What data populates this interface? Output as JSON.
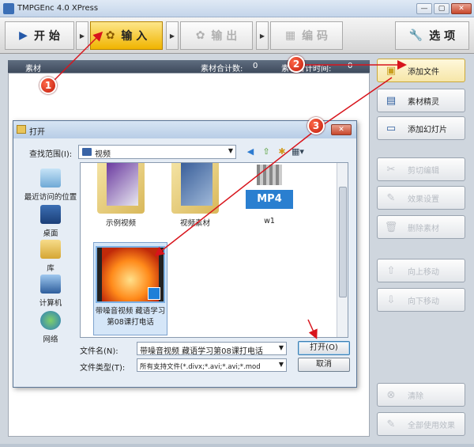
{
  "window": {
    "title": "TMPGEnc 4.0 XPress",
    "min": "—",
    "max": "▢",
    "close": "✕"
  },
  "toolbar": {
    "start": "开 始",
    "input": "输 入",
    "output": "输 出",
    "encode": "编 码",
    "options": "选 项"
  },
  "material_bar": {
    "label": "素材",
    "count_label": "素材合计数:",
    "count_value": "0",
    "time_label": "素材合计时间:",
    "time_value": "0"
  },
  "side_buttons": [
    {
      "label": "添加文件",
      "icon": "add-file-icon",
      "enabled": true
    },
    {
      "label": "素材精灵",
      "icon": "wizard-icon",
      "enabled": true
    },
    {
      "label": "添加幻灯片",
      "icon": "slideshow-icon",
      "enabled": true
    },
    {
      "label": "剪切编辑",
      "icon": "scissors-icon",
      "enabled": false
    },
    {
      "label": "效果设置",
      "icon": "effect-icon",
      "enabled": false
    },
    {
      "label": "删除素材",
      "icon": "trash-icon",
      "enabled": false
    },
    {
      "label": "向上移动",
      "icon": "arrow-up-icon",
      "enabled": false
    },
    {
      "label": "向下移动",
      "icon": "arrow-down-icon",
      "enabled": false
    },
    {
      "label": "清除",
      "icon": "clear-icon",
      "enabled": false
    },
    {
      "label": "全部使用效果",
      "icon": "apply-all-icon",
      "enabled": false
    }
  ],
  "dialog": {
    "title": "打开",
    "close": "✕",
    "look_in_label": "查找范围(I):",
    "look_in_value": "视频",
    "places": [
      "最近访问的位置",
      "桌面",
      "库",
      "计算机",
      "网络"
    ],
    "files": [
      {
        "name": "示例视频",
        "type": "folder"
      },
      {
        "name": "视频素材",
        "type": "folder"
      },
      {
        "name": "w1",
        "type": "mp4",
        "badge": "MP4"
      },
      {
        "name": "带噪音视频 藏语学习第08课打电话",
        "type": "video",
        "selected": true
      }
    ],
    "filename_label": "文件名(N):",
    "filename_value": "带噪音视频 藏语学习第08课打电话",
    "filetype_label": "文件类型(T):",
    "filetype_value": "所有支持文件(*.divx;*.avi;*.avi;*.mod",
    "open_label": "打开(O)",
    "cancel_label": "取消"
  },
  "annotations": [
    "1",
    "2",
    "3"
  ],
  "colors": {
    "accent": "#f0b400",
    "annotation": "#d8141c"
  }
}
